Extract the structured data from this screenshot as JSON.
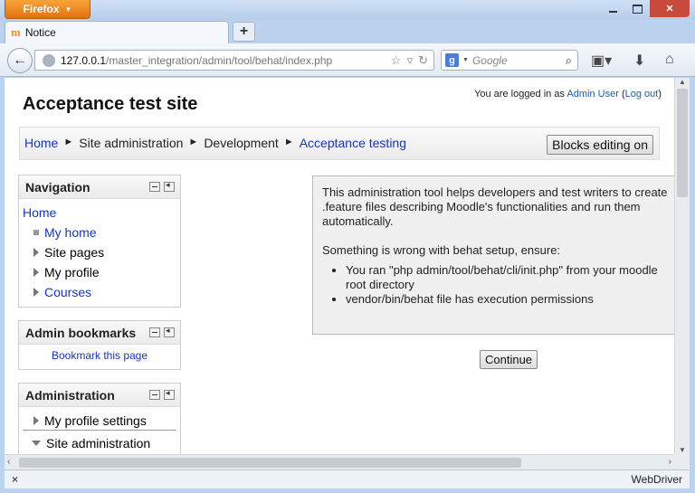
{
  "browser": {
    "menu_label": "Firefox",
    "tab_title": "Notice",
    "url_host": "127.0.0.1",
    "url_path": "/master_integration/admin/tool/behat/index.php",
    "search_placeholder": "Google",
    "search_engine_letter": "g",
    "status_x": "×",
    "status_text": "WebDriver"
  },
  "page": {
    "site_title": "Acceptance test site",
    "login": {
      "prefix": "You are logged in as",
      "user": "Admin User",
      "open": "(",
      "logout": "Log out",
      "close": ")"
    },
    "breadcrumb": {
      "home": "Home",
      "sep": "►",
      "site_admin": "Site administration",
      "development": "Development",
      "current": "Acceptance testing"
    },
    "blocks_editing_label": "Blocks editing on",
    "navigation": {
      "title": "Navigation",
      "home": "Home",
      "items": [
        "My home",
        "Site pages",
        "My profile",
        "Courses"
      ]
    },
    "admin_bookmarks": {
      "title": "Admin bookmarks",
      "link": "Bookmark this page"
    },
    "administration": {
      "title": "Administration",
      "items": [
        "My profile settings",
        "Site administration"
      ]
    },
    "notice": {
      "intro": "This administration tool helps developers and test writers to create .feature files describing Moodle's functionalities and run them automatically.",
      "problem": "Something is wrong with behat setup, ensure:",
      "checks": [
        "You ran \"php admin/tool/behat/cli/init.php\" from your moodle root directory",
        "vendor/bin/behat file has execution permissions"
      ]
    },
    "continue_label": "Continue"
  }
}
